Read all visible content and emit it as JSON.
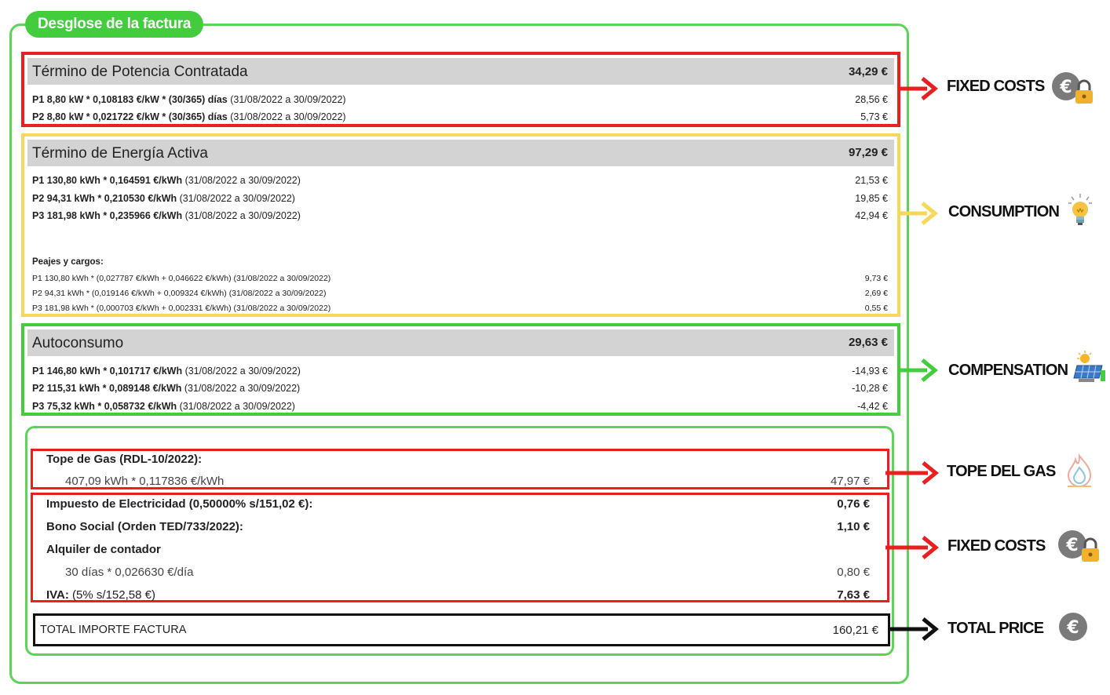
{
  "title": "Desglose de la factura",
  "potencia": {
    "title": "Término de Potencia Contratada",
    "amount": "34,29 €",
    "lines": [
      {
        "label": "P1 8,80 kW * 0,108183 €/kW * (30/365) días",
        "period": " (31/08/2022 a 30/09/2022)",
        "amount": "28,56 €"
      },
      {
        "label": "P2 8,80 kW * 0,021722 €/kW * (30/365) días",
        "period": " (31/08/2022 a 30/09/2022)",
        "amount": "5,73 €"
      }
    ]
  },
  "energia": {
    "title": "Término de Energía Activa",
    "amount": "97,29 €",
    "lines": [
      {
        "label": "P1 130,80 kWh * 0,164591 €/kWh",
        "period": " (31/08/2022 a 30/09/2022)",
        "amount": "21,53 €"
      },
      {
        "label": "P2 94,31 kWh * 0,210530 €/kWh",
        "period": " (31/08/2022 a 30/09/2022)",
        "amount": "19,85 €"
      },
      {
        "label": "P3 181,98 kWh * 0,235966 €/kWh",
        "period": " (31/08/2022 a 30/09/2022)",
        "amount": "42,94 €"
      }
    ],
    "peajes_title": "Peajes y cargos:",
    "peajes": [
      {
        "label": "P1 130,80 kWh * (0,027787 €/kWh + 0,046622 €/kWh) (31/08/2022 a 30/09/2022)",
        "amount": "9,73 €"
      },
      {
        "label": "P2 94,31 kWh * (0,019146 €/kWh + 0,009324 €/kWh) (31/08/2022 a 30/09/2022)",
        "amount": "2,69 €"
      },
      {
        "label": "P3 181,98 kWh * (0,000703 €/kWh + 0,002331 €/kWh) (31/08/2022 a 30/09/2022)",
        "amount": "0,55 €"
      }
    ]
  },
  "autoconsumo": {
    "title": "Autoconsumo",
    "amount": "29,63 €",
    "lines": [
      {
        "label": "P1 146,80 kWh * 0,101717 €/kWh",
        "period": " (31/08/2022 a 30/09/2022)",
        "amount": "-14,93 €"
      },
      {
        "label": "P2 115,31 kWh * 0,089148 €/kWh",
        "period": " (31/08/2022 a 30/09/2022)",
        "amount": "-10,28 €"
      },
      {
        "label": "P3 75,32 kWh * 0,058732 €/kWh",
        "period": " (31/08/2022 a 30/09/2022)",
        "amount": "-4,42 €"
      }
    ]
  },
  "summary": {
    "gas_title": "Tope de Gas (RDL-10/2022):",
    "gas_detail": "407,09 kWh * 0,117836 €/kWh",
    "gas_amount": "47,97 €",
    "impuesto_label": "Impuesto de Electricidad (0,50000% s/151,02 €):",
    "impuesto_amount": "0,76 €",
    "bono_label": "Bono Social (Orden TED/733/2022):",
    "bono_amount": "1,10 €",
    "alquiler_label": "Alquiler de contador",
    "alquiler_detail": "30 días * 0,026630 €/día",
    "alquiler_amount": "0,80 €",
    "iva_label": "IVA:",
    "iva_detail": " (5% s/152,58 €)",
    "iva_amount": "7,63 €",
    "total_label": "TOTAL IMPORTE FACTURA",
    "total_amount": "160,21 €"
  },
  "annotations": [
    {
      "label": "FIXED COSTS",
      "arrow_color": "#e82020",
      "icon": "euro-lock-icon"
    },
    {
      "label": "CONSUMPTION",
      "arrow_color": "#f7d85a",
      "icon": "lightbulb-icon"
    },
    {
      "label": "COMPENSATION",
      "arrow_color": "#43cc3e",
      "icon": "solar-panel-icon"
    },
    {
      "label": "TOPE  DEL GAS",
      "arrow_color": "#e82020",
      "icon": "gas-flame-icon"
    },
    {
      "label": "FIXED COSTS",
      "arrow_color": "#e82020",
      "icon": "euro-lock-icon"
    },
    {
      "label": "TOTAL PRICE",
      "arrow_color": "#111111",
      "icon": "euro-coin-icon"
    }
  ]
}
